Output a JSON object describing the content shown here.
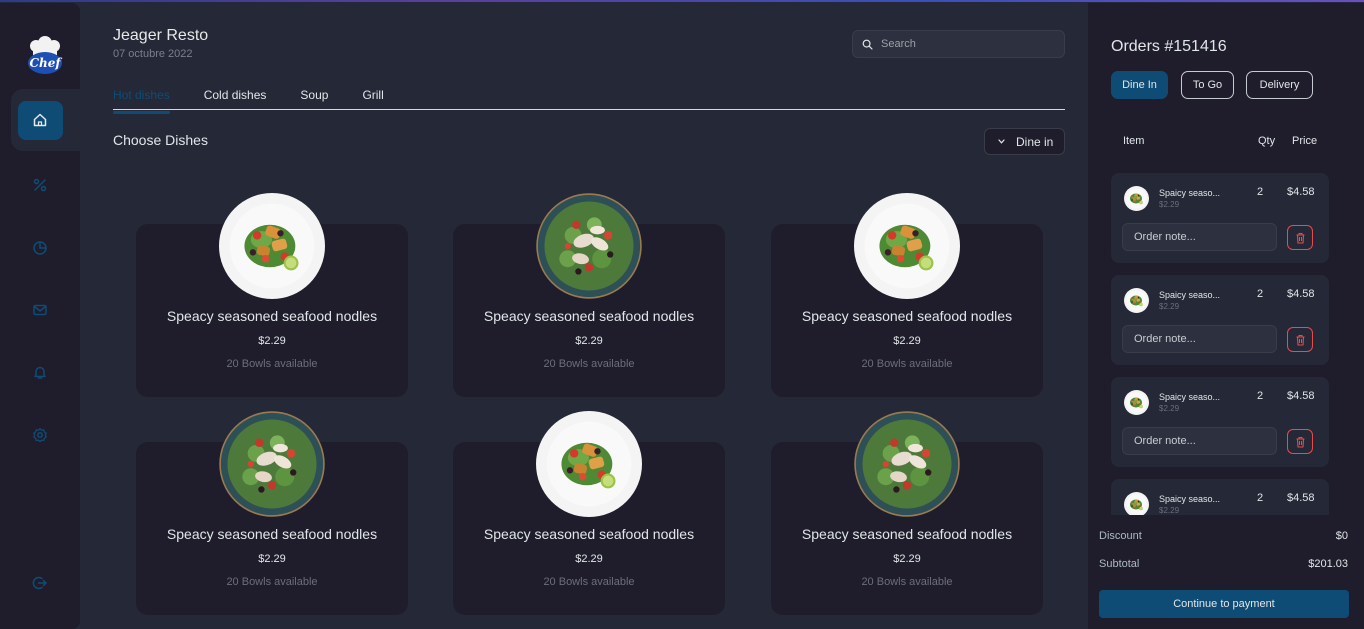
{
  "app": {
    "title": "Jeager Resto",
    "date": "07 octubre 2022",
    "logo_text": "Chef"
  },
  "colors": {
    "accent": "#0f4c75",
    "background": "#252836",
    "panel": "#1f1d2b",
    "danger": "#ea4a4a"
  },
  "sidebar": {
    "items": [
      {
        "name": "home",
        "icon": "home-icon",
        "active": true
      },
      {
        "name": "discount",
        "icon": "percent-icon",
        "active": false
      },
      {
        "name": "dashboard",
        "icon": "pie-chart-icon",
        "active": false
      },
      {
        "name": "messages",
        "icon": "mail-icon",
        "active": false
      },
      {
        "name": "notifications",
        "icon": "bell-icon",
        "active": false
      },
      {
        "name": "settings",
        "icon": "gear-icon",
        "active": false
      },
      {
        "name": "logout",
        "icon": "logout-icon",
        "active": false
      }
    ]
  },
  "search": {
    "placeholder": "Search"
  },
  "tabs": [
    {
      "label": "Hot dishes",
      "active": true
    },
    {
      "label": "Cold dishes",
      "active": false
    },
    {
      "label": "Soup",
      "active": false
    },
    {
      "label": "Grill",
      "active": false
    }
  ],
  "main": {
    "section_title": "Choose Dishes",
    "dine_option": "Dine in"
  },
  "dishes": [
    {
      "name": "Speacy seasoned seafood nodles",
      "price": "$2.29",
      "availability": "20 Bowls available",
      "image": "white-plate-salad"
    },
    {
      "name": "Speacy seasoned seafood nodles",
      "price": "$2.29",
      "availability": "20 Bowls available",
      "image": "dark-bowl-salad"
    },
    {
      "name": "Speacy seasoned seafood nodles",
      "price": "$2.29",
      "availability": "20 Bowls available",
      "image": "white-plate-salad"
    },
    {
      "name": "Speacy seasoned seafood nodles",
      "price": "$2.29",
      "availability": "20 Bowls available",
      "image": "dark-bowl-salad"
    },
    {
      "name": "Speacy seasoned seafood nodles",
      "price": "$2.29",
      "availability": "20 Bowls available",
      "image": "white-plate-salad"
    },
    {
      "name": "Speacy seasoned seafood nodles",
      "price": "$2.29",
      "availability": "20 Bowls available",
      "image": "dark-bowl-salad"
    }
  ],
  "orders": {
    "title": "Orders #151416",
    "types": [
      {
        "label": "Dine In",
        "active": true
      },
      {
        "label": "To Go",
        "active": false
      },
      {
        "label": "Delivery",
        "active": false
      }
    ],
    "columns": {
      "item": "Item",
      "qty": "Qty",
      "price": "Price"
    },
    "note_placeholder": "Order note...",
    "items": [
      {
        "name": "Spaicy seaso...",
        "unit_price": "$2.29",
        "qty": "2",
        "total": "$4.58"
      },
      {
        "name": "Spaicy seaso...",
        "unit_price": "$2.29",
        "qty": "2",
        "total": "$4.58"
      },
      {
        "name": "Spaicy seaso...",
        "unit_price": "$2.29",
        "qty": "2",
        "total": "$4.58"
      },
      {
        "name": "Spaicy seaso...",
        "unit_price": "$2.29",
        "qty": "2",
        "total": "$4.58"
      }
    ],
    "discount_label": "Discount",
    "discount_value": "$0",
    "subtotal_label": "Subtotal",
    "subtotal_value": "$201.03",
    "pay_button": "Continue to payment"
  }
}
